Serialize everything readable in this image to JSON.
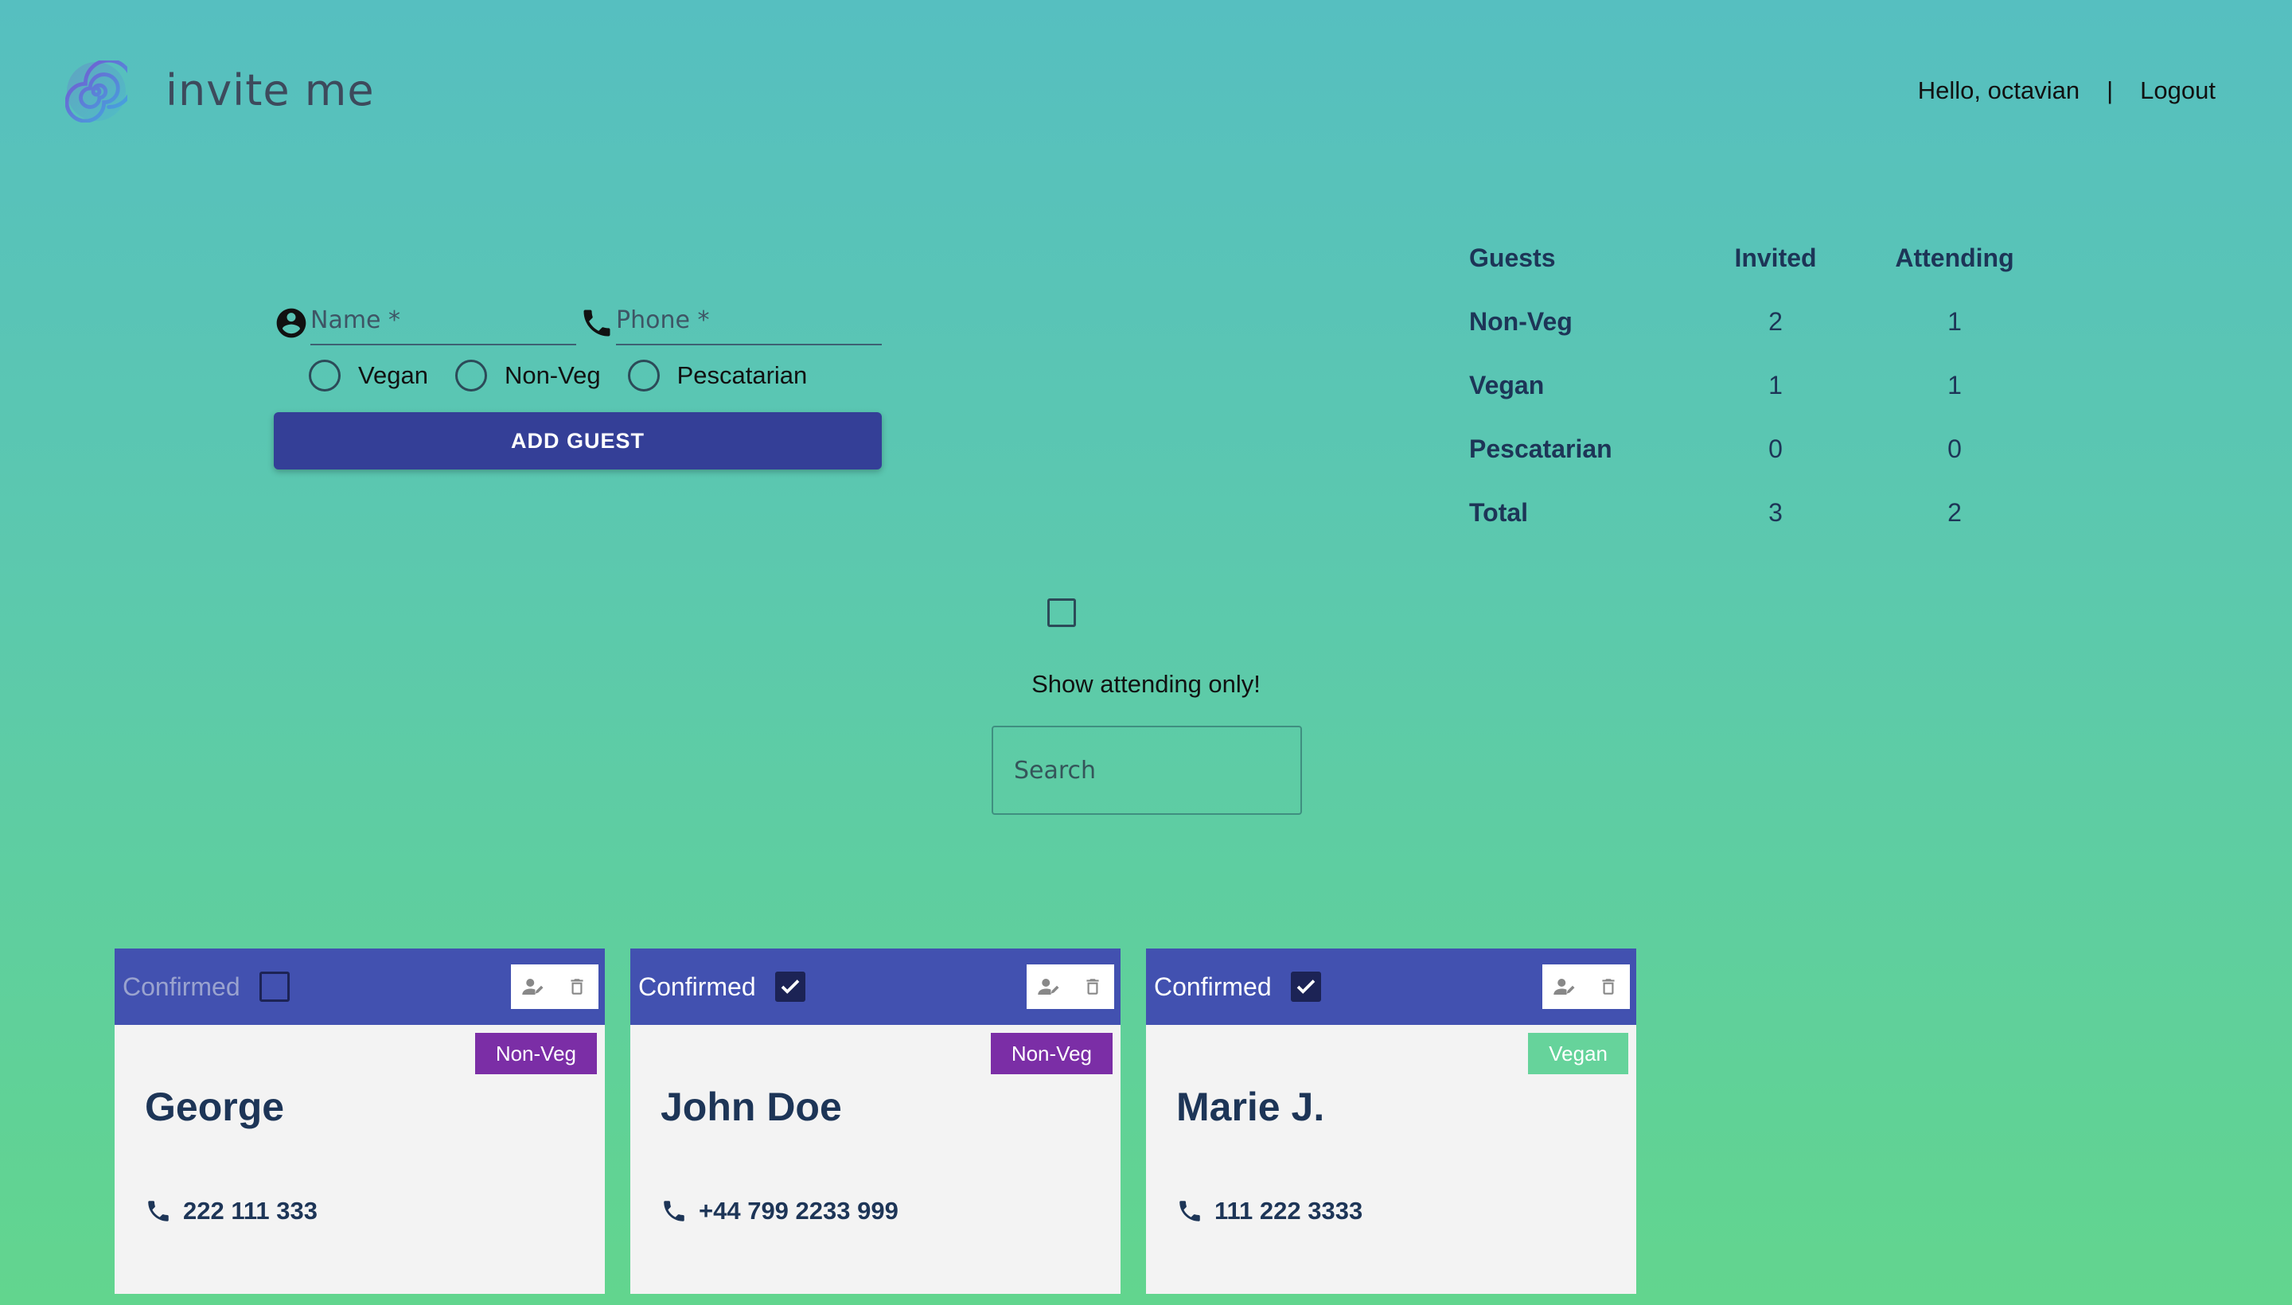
{
  "header": {
    "brand": "invite me",
    "greeting": "Hello, octavian",
    "separator": "|",
    "logout": "Logout"
  },
  "form": {
    "name_placeholder": "Name *",
    "phone_placeholder": "Phone *",
    "diets": [
      "Vegan",
      "Non-Veg",
      "Pescatarian"
    ],
    "add_button": "ADD GUEST"
  },
  "stats": {
    "headers": [
      "Guests",
      "Invited",
      "Attending"
    ],
    "rows": [
      {
        "label": "Non-Veg",
        "invited": "2",
        "attending": "1"
      },
      {
        "label": "Vegan",
        "invited": "1",
        "attending": "1"
      },
      {
        "label": "Pescatarian",
        "invited": "0",
        "attending": "0"
      },
      {
        "label": "Total",
        "invited": "3",
        "attending": "2"
      }
    ]
  },
  "filter": {
    "label": "Show attending only!",
    "checked": false,
    "search_placeholder": "Search"
  },
  "guests": [
    {
      "name": "George",
      "phone": "222 111 333",
      "diet": "Non-Veg",
      "confirmed_label": "Confirmed",
      "confirmed": false
    },
    {
      "name": "John Doe",
      "phone": "+44 799 2233 999",
      "diet": "Non-Veg",
      "confirmed_label": "Confirmed",
      "confirmed": true
    },
    {
      "name": "Marie J.",
      "phone": "111 222 3333",
      "diet": "Vegan",
      "confirmed_label": "Confirmed",
      "confirmed": true
    }
  ],
  "colors": {
    "primary": "#343f97",
    "card_header": "#4251b0",
    "nonveg_badge": "#7b2ea6",
    "vegan_badge": "#66d39b",
    "text_dark": "#1d3557"
  },
  "icons": {
    "logo": "spiral-logo-icon",
    "name": "account-circle-icon",
    "phone": "phone-icon",
    "edit": "edit-user-icon",
    "delete": "trash-icon"
  }
}
